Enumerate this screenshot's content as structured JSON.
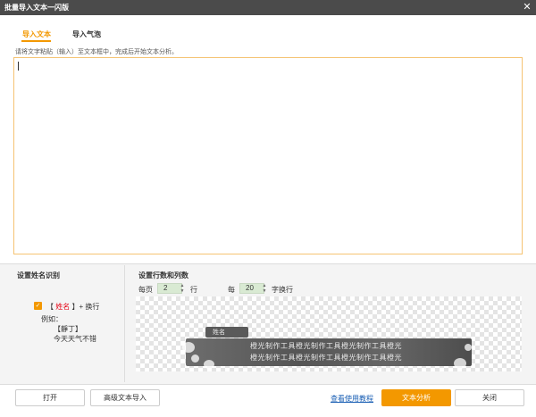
{
  "window": {
    "title": "批量导入文本一闪版",
    "close_glyph": "✕"
  },
  "tabs": [
    {
      "label": "导入文本",
      "active": true
    },
    {
      "label": "导入气泡",
      "active": false
    }
  ],
  "hint": "请将文字粘贴（输入）至文本框中，完成后开始文本分析。",
  "text_input": {
    "value": ""
  },
  "name_section": {
    "title": "设置姓名识别",
    "checked": true,
    "rule_open": "【",
    "rule_name": "姓名",
    "rule_close": "】+ 换行",
    "example_label": "例如：",
    "example_line1": "【靜丁】",
    "example_line2": "今天天气不错"
  },
  "rows_section": {
    "title": "设置行数和列数",
    "per_page_label": "每页",
    "per_page_value": "2",
    "rows_unit": "行",
    "every_label": "每",
    "chars_value": "20",
    "chars_unit": "字换行"
  },
  "preview": {
    "name_text": "姓名",
    "line1": "橙光制作工具橙光制作工具橙光制作工具橙光",
    "line2": "橙光制作工具橙光制作工具橙光制作工具橙光"
  },
  "buttons": {
    "open": "打开",
    "advanced_import": "高级文本导入",
    "tutorial_link": "查看使用教程",
    "analyze": "文本分析",
    "close": "关闭"
  },
  "colors": {
    "accent": "#f39800",
    "title_bar": "#4b4b4b",
    "link": "#1a5fb4",
    "name_red": "#e60012"
  }
}
